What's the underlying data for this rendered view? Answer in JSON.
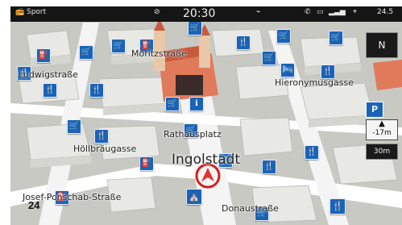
{
  "status_bar": {
    "source": "Sport",
    "time": "20:30",
    "temperature": "24.5"
  },
  "map": {
    "streets": [
      "Ludwigstraße",
      "Moritzstraße",
      "Hieronymusgasse",
      "Rathausplatz",
      "Höllbräugasse",
      "Josef-Ponschab-Straße",
      "Donaustraße"
    ],
    "city_label": "Ingolstadt",
    "distance_label": "24"
  },
  "side_panel": {
    "compass_label": "N",
    "parking_label": "P",
    "altitude_label": "-17m",
    "scale_label": "30m"
  },
  "icons": {
    "restaurant": "fork-knife-icon",
    "shop": "cart-icon",
    "info": "info-icon",
    "fuel": "fuel-icon",
    "hotel": "bed-icon",
    "landmark": "church-icon"
  }
}
